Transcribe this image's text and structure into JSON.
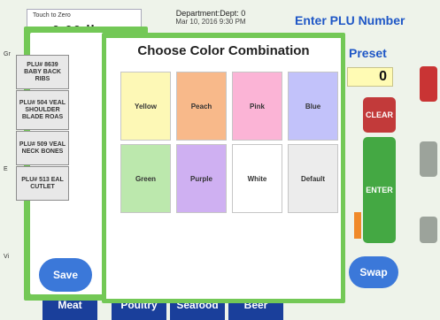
{
  "background": {
    "touch_to_zero_label": "Touch to Zero",
    "scale_value": "0.00 lb",
    "department": "Department:Dept: 0",
    "date": "Mar 10, 2016     9:30 PM",
    "enter_plu_title": "Enter PLU Number",
    "reset_label": "Preset",
    "display_value": "0",
    "clear_label": "CLEAR",
    "enter_label": "ENTER",
    "swap_label": "Swap",
    "left_labels": [
      "Gr",
      "E",
      "Vi"
    ],
    "category_tabs": [
      "Meat",
      "Poultry",
      "Seafood",
      "Beer"
    ]
  },
  "plu_popup": {
    "items": [
      {
        "label": "PLU# 8639 BABY BACK RIBS"
      },
      {
        "label": "PLU# 504 VEAL SHOULDER BLADE ROAS"
      },
      {
        "label": "PLU# 509 VEAL NECK BONES"
      },
      {
        "label": "PLU# 513 EAL CUTLET"
      }
    ],
    "save_label": "Save"
  },
  "color_modal": {
    "title": "Choose Color Combination",
    "options": [
      {
        "label": "Yellow",
        "color": "#fdf8b6"
      },
      {
        "label": "Peach",
        "color": "#f8b98a"
      },
      {
        "label": "Pink",
        "color": "#fbb4d6"
      },
      {
        "label": "Blue",
        "color": "#c2c2fa"
      },
      {
        "label": "Green",
        "color": "#bce8ad"
      },
      {
        "label": "Purple",
        "color": "#cfb0f2"
      },
      {
        "label": "White",
        "color": "#ffffff"
      },
      {
        "label": "Default",
        "color": "#ececec"
      }
    ]
  }
}
